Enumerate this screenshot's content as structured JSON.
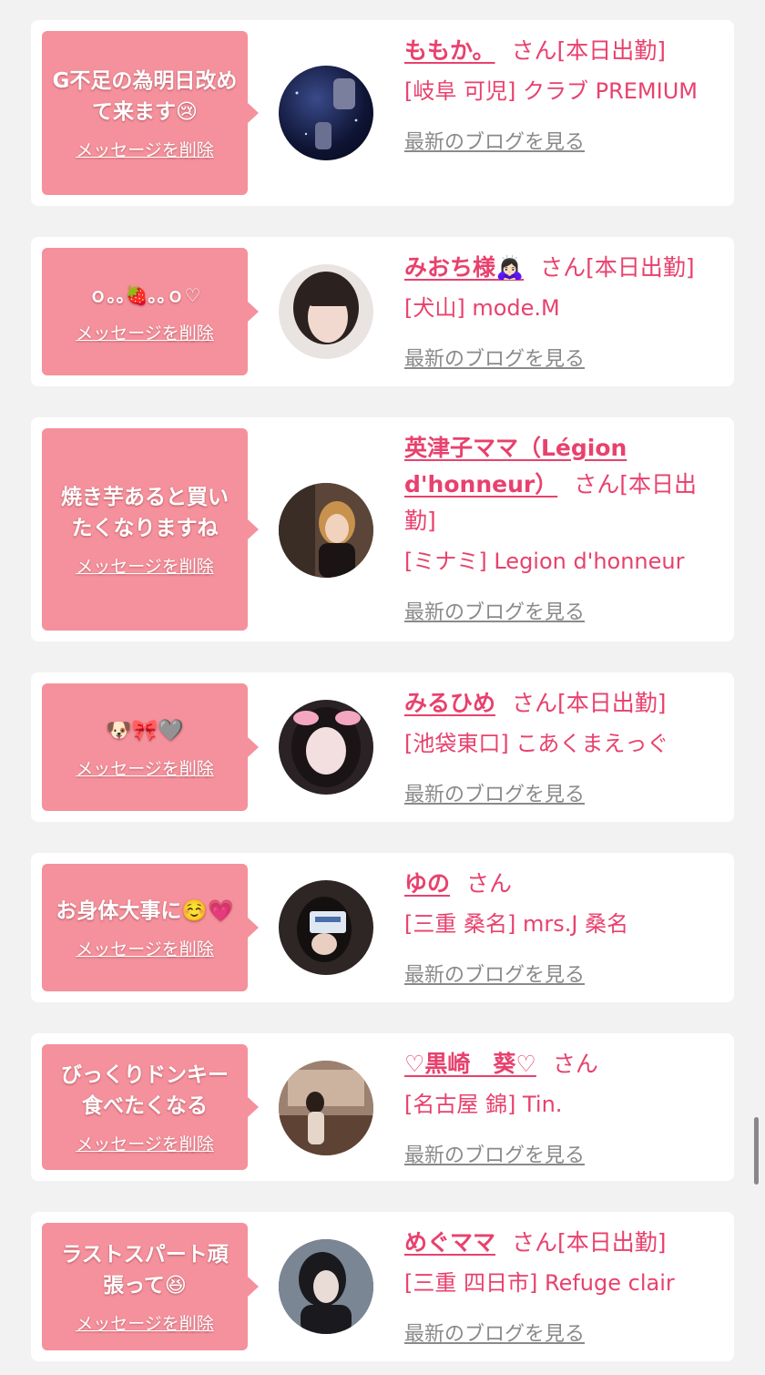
{
  "cards": [
    {
      "message": "G不足の為明日改めて来ます😢",
      "delete_label": "メッセージを削除",
      "name": "ももか。",
      "honorific": "さん[本日出勤]",
      "shop": "[岐阜 可児] クラブ PREMIUM",
      "blog_label": "最新のブログを見る"
    },
    {
      "message": "ｏ｡｡🍓｡｡ｏ♡",
      "delete_label": "メッセージを削除",
      "name": "みおち様🙇🏻‍♀️",
      "honorific": "さん[本日出勤]",
      "shop": "[犬山] mode.M",
      "blog_label": "最新のブログを見る"
    },
    {
      "message": "焼き芋あると買いたくなりますね",
      "delete_label": "メッセージを削除",
      "name": "英津子ママ（Légion d'honneur）",
      "honorific": "さん[本日出勤]",
      "shop": "[ミナミ] Legion d'honneur",
      "blog_label": "最新のブログを見る"
    },
    {
      "message": "🐶🎀🩶",
      "delete_label": "メッセージを削除",
      "name": "みるひめ",
      "honorific": "さん[本日出勤]",
      "shop": "[池袋東口] こあくまえっぐ",
      "blog_label": "最新のブログを見る"
    },
    {
      "message": "お身体大事に☺️💗",
      "delete_label": "メッセージを削除",
      "name": "ゆの",
      "honorific": "さん",
      "shop": "[三重 桑名] mrs.J 桑名",
      "blog_label": "最新のブログを見る"
    },
    {
      "message": "びっくりドンキー食べたくなる",
      "delete_label": "メッセージを削除",
      "name": "♡黒崎　葵♡",
      "honorific": "さん",
      "shop": "[名古屋 錦] Tin.",
      "blog_label": "最新のブログを見る"
    },
    {
      "message": "ラストスパート頑張って😆",
      "delete_label": "メッセージを削除",
      "name": "めぐママ",
      "honorific": "さん[本日出勤]",
      "shop": "[三重 四日市] Refuge clair",
      "blog_label": "最新のブログを見る"
    }
  ]
}
